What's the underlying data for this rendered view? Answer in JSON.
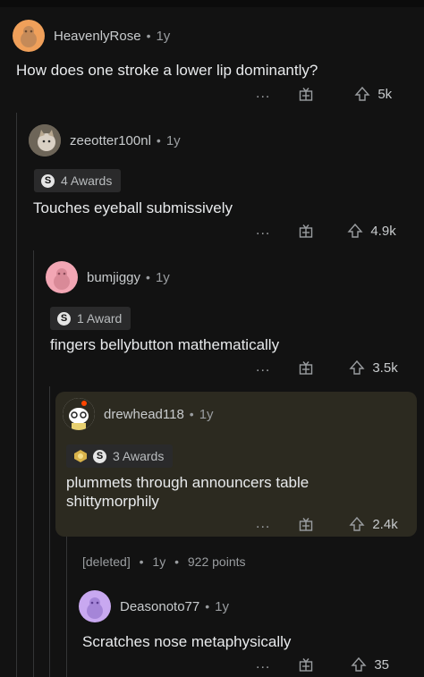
{
  "comments": [
    {
      "username": "HeavenlyRose",
      "age": "1y",
      "body": "How does one stroke a lower lip dominantly?",
      "more": "...",
      "score": "5k",
      "avatar_color": "#f0a05a"
    },
    {
      "username": "zeeotter100nl",
      "age": "1y",
      "awards": "4 Awards",
      "body": "Touches eyeball submissively",
      "more": "...",
      "score": "4.9k",
      "avatar_color": "#8a8070"
    },
    {
      "username": "bumjiggy",
      "age": "1y",
      "awards": "1 Award",
      "body": "fingers bellybutton mathematically",
      "more": "...",
      "score": "3.5k",
      "avatar_color": "#f2a6b4"
    },
    {
      "username": "drewhead118",
      "age": "1y",
      "awards": "3 Awards",
      "body": "plummets through announcers table shittymorphily",
      "more": "...",
      "score": "2.4k",
      "avatar_color": "#ffffff"
    },
    {
      "username": "[deleted]",
      "age": "1y",
      "points": "922 points"
    },
    {
      "username": "Deasonoto77",
      "age": "1y",
      "body": "Scratches nose metaphysically",
      "more": "...",
      "score": "35",
      "avatar_color": "#c8a8f0"
    }
  ],
  "separator": "•",
  "icons": {
    "more": "ellipsis-icon",
    "gift": "gift-icon",
    "upvote": "upvote-arrow-icon",
    "award": "silver-award-icon"
  }
}
